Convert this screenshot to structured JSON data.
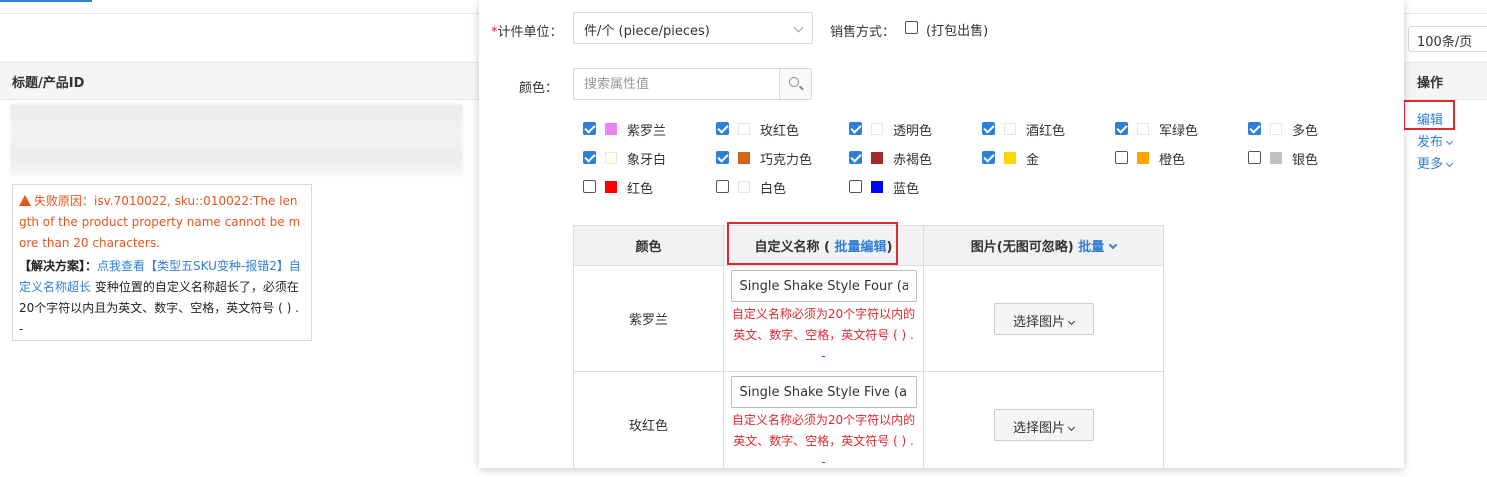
{
  "background": {
    "column_title": "标题/产品ID",
    "column_ops": "操作",
    "page_size": "100条/页",
    "error": {
      "reason_label": "失败原因：",
      "reason_text": "isv.7010022, sku::010022:The length of the product property name cannot be more than 20 characters.",
      "solution_label": "【解决方案】：",
      "solution_link": "点我查看【类型五SKU变种-报错2】自定义名称超长",
      "solution_text": " 变种位置的自定义名称超长了，必须在20个字符以内且为英文、数字、空格，英文符号 ( ) . -"
    },
    "ops": {
      "edit": "编辑",
      "publish": "发布",
      "more": "更多"
    }
  },
  "modal": {
    "unit": {
      "label": "计件单位：",
      "value": "件/个 (piece/pieces)"
    },
    "sale": {
      "label": "销售方式：",
      "option": "(打包出售)"
    },
    "color": {
      "label": "颜色：",
      "search_placeholder": "搜索属性值",
      "items": [
        {
          "name": "紫罗兰",
          "checked": true,
          "swatch": "#ee82ee"
        },
        {
          "name": "玫红色",
          "checked": true,
          "swatch": "#ffffff"
        },
        {
          "name": "透明色",
          "checked": true,
          "swatch": "#ffffff"
        },
        {
          "name": "酒红色",
          "checked": true,
          "swatch": "#ffffff"
        },
        {
          "name": "军绿色",
          "checked": true,
          "swatch": "#ffffff"
        },
        {
          "name": "多色",
          "checked": true,
          "swatch": "#ffffff"
        },
        {
          "name": "象牙白",
          "checked": true,
          "swatch": "#fffff0"
        },
        {
          "name": "巧克力色",
          "checked": true,
          "swatch": "#d2691e"
        },
        {
          "name": "赤褐色",
          "checked": true,
          "swatch": "#a52a2a"
        },
        {
          "name": "金",
          "checked": true,
          "swatch": "#ffd700"
        },
        {
          "name": "橙色",
          "checked": false,
          "swatch": "#ffa500"
        },
        {
          "name": "银色",
          "checked": false,
          "swatch": "#c0c0c0"
        },
        {
          "name": "红色",
          "checked": false,
          "swatch": "#ff0000"
        },
        {
          "name": "白色",
          "checked": false,
          "swatch": "#ffffff"
        },
        {
          "name": "蓝色",
          "checked": false,
          "swatch": "#0000ff"
        }
      ]
    },
    "table": {
      "col_color": "颜色",
      "col_custom": "自定义名称",
      "col_custom_batch": "批量编辑",
      "col_image": "图片(无图可忽略)",
      "col_image_batch": "批量",
      "rows": [
        {
          "color": "紫罗兰",
          "custom_name": "Single Shake Style Four (abs",
          "error": "自定义名称必须为20个字符以内的英文、数字、空格，英文符号 ( ) . -",
          "pick": "选择图片"
        },
        {
          "color": "玫红色",
          "custom_name": "Single Shake Style Five (abs",
          "error": "自定义名称必须为20个字符以内的英文、数字、空格，英文符号 ( ) . -",
          "pick": "选择图片"
        }
      ]
    }
  }
}
